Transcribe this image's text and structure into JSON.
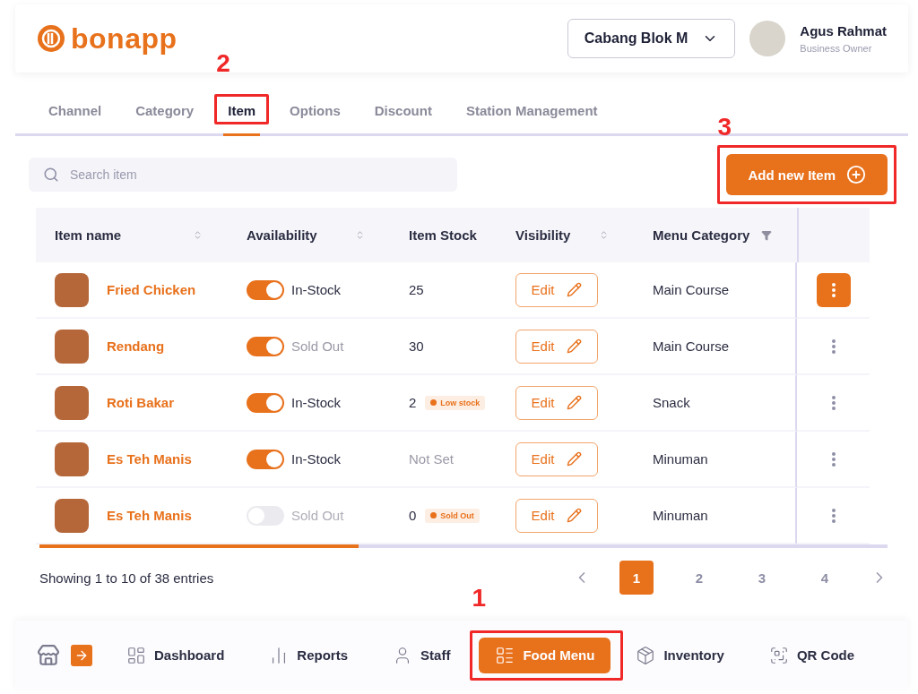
{
  "header": {
    "logo": "bonapp",
    "branch": "Cabang Blok M",
    "user": {
      "name": "Agus Rahmat",
      "role": "Business Owner"
    }
  },
  "tabs": [
    {
      "label": "Channel",
      "selected": false
    },
    {
      "label": "Category",
      "selected": false
    },
    {
      "label": "Item",
      "selected": true,
      "callout": "2"
    },
    {
      "label": "Options",
      "selected": false
    },
    {
      "label": "Discount",
      "selected": false
    },
    {
      "label": "Station Management",
      "selected": false
    }
  ],
  "search": {
    "placeholder": "Search item"
  },
  "add_button": {
    "label": "Add new Item",
    "callout": "3"
  },
  "table": {
    "columns": [
      {
        "label": "Item name",
        "kind": "sort"
      },
      {
        "label": "Availability",
        "kind": "sort"
      },
      {
        "label": "Item Stock",
        "kind": "plain"
      },
      {
        "label": "Visibility",
        "kind": "sort"
      },
      {
        "label": "Menu Category",
        "kind": "filter"
      }
    ],
    "rows": [
      {
        "name": "Fried Chicken",
        "on": true,
        "availability": "In-Stock",
        "available": true,
        "stock": "25",
        "stock_set": true,
        "visibility": "Edit",
        "category": "Main Course",
        "menu_active": true
      },
      {
        "name": "Rendang",
        "on": true,
        "availability": "Sold Out",
        "available": false,
        "stock": "30",
        "stock_set": true,
        "visibility": "Edit",
        "category": "Main Course",
        "menu_active": false
      },
      {
        "name": "Roti Bakar",
        "on": true,
        "availability": "In-Stock",
        "available": true,
        "stock": "2",
        "stock_set": true,
        "badge": "Low stock",
        "visibility": "Edit",
        "category": "Snack",
        "menu_active": false
      },
      {
        "name": "Es Teh Manis",
        "on": true,
        "availability": "In-Stock",
        "available": true,
        "stock": "Not Set",
        "stock_set": false,
        "visibility": "Edit",
        "category": "Minuman",
        "menu_active": false
      },
      {
        "name": "Es Teh Manis",
        "on": false,
        "availability": "Sold Out",
        "available": false,
        "stock": "0",
        "stock_set": true,
        "badge": "Sold Out",
        "visibility": "Edit",
        "category": "Minuman",
        "menu_active": false
      }
    ]
  },
  "pagination": {
    "summary": "Showing 1 to 10 of 38 entries",
    "pages": [
      {
        "label": "1",
        "selected": true
      },
      {
        "label": "2",
        "selected": false
      },
      {
        "label": "3",
        "selected": false
      },
      {
        "label": "4",
        "selected": false
      }
    ]
  },
  "bottom_nav": [
    {
      "label": "Dashboard",
      "selected": false
    },
    {
      "label": "Reports",
      "selected": false
    },
    {
      "label": "Staff",
      "selected": false
    },
    {
      "label": "Food Menu",
      "selected": true,
      "callout": "1"
    },
    {
      "label": "Inventory",
      "selected": false
    },
    {
      "label": "QR Code",
      "selected": false
    }
  ]
}
